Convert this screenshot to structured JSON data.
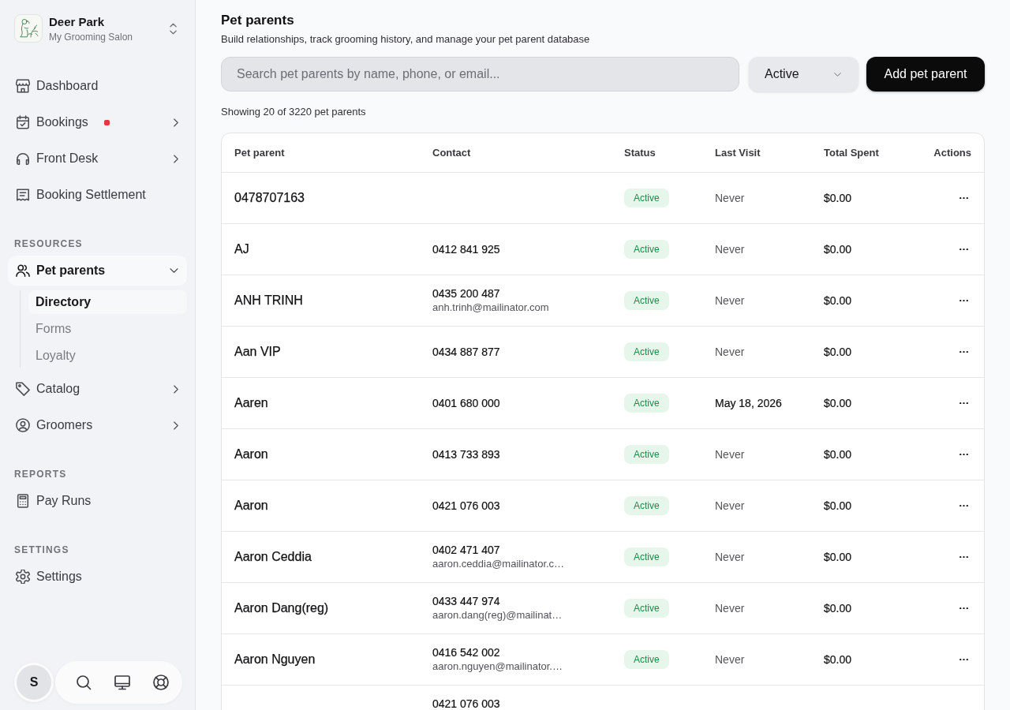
{
  "org": {
    "name": "Deer Park",
    "subtitle": "My Grooming Salon"
  },
  "sidebar": {
    "sections": [
      {
        "items": [
          {
            "label": "Dashboard",
            "selected": false,
            "alert": false
          },
          {
            "label": "Bookings",
            "selected": false,
            "alert": true,
            "expanded": false
          },
          {
            "label": "Front Desk",
            "selected": false,
            "alert": false,
            "expanded": false
          },
          {
            "label": "Booking Settlement",
            "selected": false,
            "alert": false
          }
        ]
      },
      {
        "heading": "RESOURCES",
        "items": [
          {
            "label": "Pet parents",
            "selected": true,
            "alert": false,
            "expanded": true,
            "children": [
              {
                "label": "Directory",
                "selected": true
              },
              {
                "label": "Forms",
                "selected": false
              },
              {
                "label": "Loyalty",
                "selected": false
              }
            ]
          },
          {
            "label": "Catalog",
            "selected": false,
            "alert": false,
            "expanded": false
          },
          {
            "label": "Groomers",
            "selected": false,
            "alert": false,
            "expanded": false
          }
        ]
      },
      {
        "heading": "REPORTS",
        "items": [
          {
            "label": "Pay Runs",
            "selected": false,
            "alert": false
          }
        ]
      },
      {
        "heading": "SETTINGS",
        "items": [
          {
            "label": "Settings",
            "selected": false,
            "alert": false
          }
        ]
      }
    ]
  },
  "user": {
    "initial": "S"
  },
  "page": {
    "title": "Pet parents",
    "subtitle": "Build relationships, track grooming history, and manage your pet parent database",
    "search": {
      "placeholder": "Search pet parents by name, phone, or email..."
    },
    "status_filter": {
      "value": "Active"
    },
    "add_button": "Add pet parent",
    "result_count": "Showing 20 of 3220 pet parents"
  },
  "table": {
    "columns": [
      "Pet parent",
      "Contact",
      "Status",
      "Last Visit",
      "Total Spent",
      "Actions"
    ],
    "rows": [
      {
        "name": "0478707163",
        "status": "Active",
        "last_visit": "Never",
        "visited": false,
        "total": "$0.00"
      },
      {
        "name": "AJ",
        "phone": "0412 841 925",
        "status": "Active",
        "last_visit": "Never",
        "visited": false,
        "total": "$0.00"
      },
      {
        "name": "ANH TRINH",
        "phone": "0435 200 487",
        "email": "anh.trinh@mailinator.com",
        "status": "Active",
        "last_visit": "Never",
        "visited": false,
        "total": "$0.00"
      },
      {
        "name": "Aan VIP",
        "phone": "0434 887 877",
        "status": "Active",
        "last_visit": "Never",
        "visited": false,
        "total": "$0.00"
      },
      {
        "name": "Aaren",
        "phone": "0401 680 000",
        "status": "Active",
        "last_visit": "May 18, 2026",
        "visited": true,
        "total": "$0.00"
      },
      {
        "name": "Aaron",
        "phone": "0413 733 893",
        "status": "Active",
        "last_visit": "Never",
        "visited": false,
        "total": "$0.00"
      },
      {
        "name": "Aaron",
        "phone": "0421 076 003",
        "status": "Active",
        "last_visit": "Never",
        "visited": false,
        "total": "$0.00"
      },
      {
        "name": "Aaron Ceddia",
        "phone": "0402 471 407",
        "email": "aaron.ceddia@mailinator.c…",
        "status": "Active",
        "last_visit": "Never",
        "visited": false,
        "total": "$0.00"
      },
      {
        "name": "Aaron Dang(reg)",
        "phone": "0433 447 974",
        "email": "aaron.dang(reg)@mailinat…",
        "status": "Active",
        "last_visit": "Never",
        "visited": false,
        "total": "$0.00"
      },
      {
        "name": "Aaron Nguyen",
        "phone": "0416 542 002",
        "email": "aaron.nguyen@mailinator.…",
        "status": "Active",
        "last_visit": "Never",
        "visited": false,
        "total": "$0.00"
      },
      {
        "phone": "0421 076 003"
      }
    ]
  }
}
